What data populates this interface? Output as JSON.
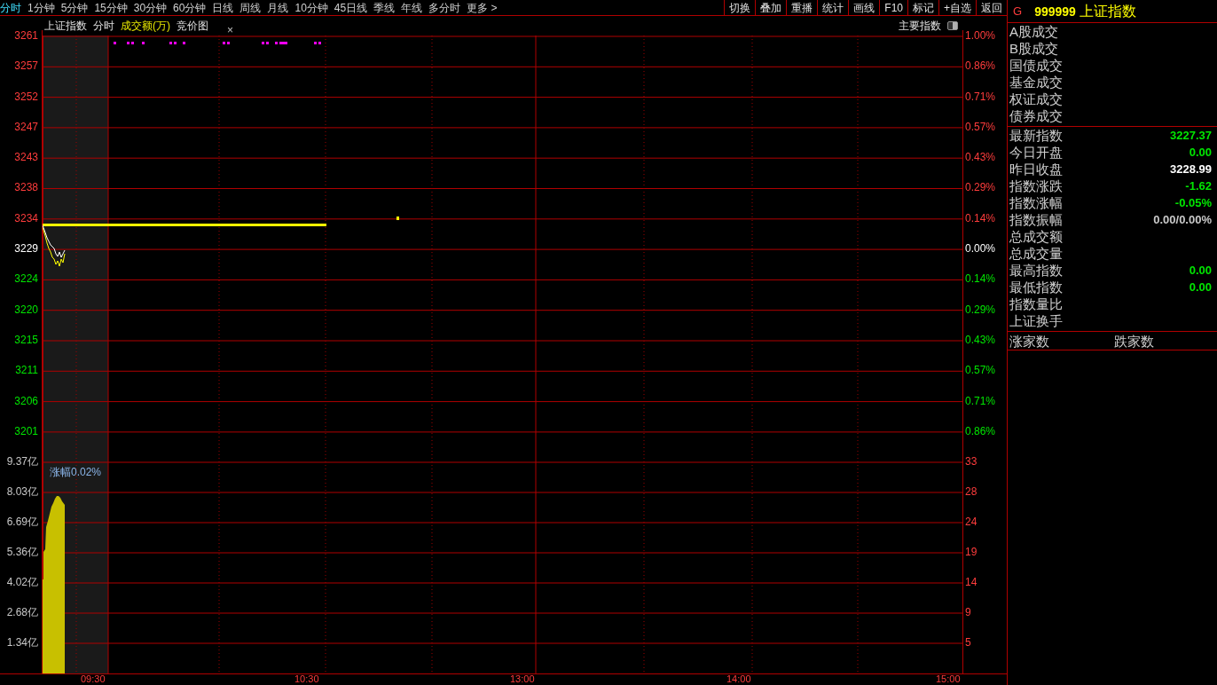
{
  "periods": [
    {
      "label": "分时",
      "selected": true
    },
    {
      "label": "1分钟",
      "selected": false
    },
    {
      "label": "5分钟",
      "selected": false
    },
    {
      "label": "15分钟",
      "selected": false
    },
    {
      "label": "30分钟",
      "selected": false
    },
    {
      "label": "60分钟",
      "selected": false
    },
    {
      "label": "日线",
      "selected": false
    },
    {
      "label": "周线",
      "selected": false
    },
    {
      "label": "月线",
      "selected": false
    },
    {
      "label": "10分钟",
      "selected": false
    },
    {
      "label": "45日线",
      "selected": false
    },
    {
      "label": "季线",
      "selected": false
    },
    {
      "label": "年线",
      "selected": false
    },
    {
      "label": "多分时",
      "selected": false
    },
    {
      "label": "更多 >",
      "selected": false
    }
  ],
  "toolbar_buttons": [
    "切换",
    "叠加",
    "重播",
    "统计",
    "画线",
    "F10",
    "标记",
    "+自选",
    "返回"
  ],
  "chart_header": {
    "title": "上证指数",
    "tabs": [
      {
        "label": "分时",
        "kind": "plain"
      },
      {
        "label": "成交额(万)",
        "kind": "highlight"
      },
      {
        "label": "竞价图",
        "kind": "plain"
      }
    ],
    "close_mark": "×",
    "index_label": "主要指数"
  },
  "price_axis": [
    {
      "label": "3261",
      "kind": "up"
    },
    {
      "label": "3257",
      "kind": "up"
    },
    {
      "label": "3252",
      "kind": "up"
    },
    {
      "label": "3247",
      "kind": "up"
    },
    {
      "label": "3243",
      "kind": "up"
    },
    {
      "label": "3238",
      "kind": "up"
    },
    {
      "label": "3234",
      "kind": "up"
    },
    {
      "label": "3229",
      "kind": "flat"
    },
    {
      "label": "3224",
      "kind": "down"
    },
    {
      "label": "3220",
      "kind": "down"
    },
    {
      "label": "3215",
      "kind": "down"
    },
    {
      "label": "3211",
      "kind": "down"
    },
    {
      "label": "3206",
      "kind": "down"
    },
    {
      "label": "3201",
      "kind": "down"
    }
  ],
  "percent_axis": [
    {
      "label": "1.00%",
      "kind": "up"
    },
    {
      "label": "0.86%",
      "kind": "up"
    },
    {
      "label": "0.71%",
      "kind": "up"
    },
    {
      "label": "0.57%",
      "kind": "up"
    },
    {
      "label": "0.43%",
      "kind": "up"
    },
    {
      "label": "0.29%",
      "kind": "up"
    },
    {
      "label": "0.14%",
      "kind": "up"
    },
    {
      "label": "0.00%",
      "kind": "flat"
    },
    {
      "label": "0.14%",
      "kind": "down"
    },
    {
      "label": "0.29%",
      "kind": "down"
    },
    {
      "label": "0.43%",
      "kind": "down"
    },
    {
      "label": "0.57%",
      "kind": "down"
    },
    {
      "label": "0.71%",
      "kind": "down"
    },
    {
      "label": "0.86%",
      "kind": "down"
    }
  ],
  "volume_axis": [
    "9.37亿",
    "8.03亿",
    "6.69亿",
    "5.36亿",
    "4.02亿",
    "2.68亿",
    "1.34亿"
  ],
  "volume_right_axis": [
    "33",
    "28",
    "24",
    "19",
    "14",
    "9",
    "5"
  ],
  "volume_note": "涨幅0.02%",
  "time_axis": [
    "09:30",
    "10:30",
    "13:00",
    "14:00",
    "15:00"
  ],
  "side_panel": {
    "market": "G",
    "code": "999999",
    "name": "上证指数",
    "turnover_rows": [
      "A股成交",
      "B股成交",
      "国债成交",
      "基金成交",
      "权证成交",
      "债券成交"
    ],
    "stats": [
      {
        "label": "最新指数",
        "value": "3227.37",
        "kind": "down"
      },
      {
        "label": "今日开盘",
        "value": "0.00",
        "kind": "down"
      },
      {
        "label": "昨日收盘",
        "value": "3228.99",
        "kind": "flat"
      },
      {
        "label": "指数涨跌",
        "value": "-1.62",
        "kind": "down"
      },
      {
        "label": "指数涨幅",
        "value": "-0.05%",
        "kind": "down"
      },
      {
        "label": "指数振幅",
        "value": "0.00/0.00%",
        "kind": "neutral"
      },
      {
        "label": "总成交额"
      },
      {
        "label": "总成交量"
      },
      {
        "label": "最高指数",
        "value": "0.00",
        "kind": "down"
      },
      {
        "label": "最低指数",
        "value": "0.00",
        "kind": "down"
      },
      {
        "label": "指数量比"
      },
      {
        "label": "上证换手"
      }
    ],
    "breadth": [
      "涨家数",
      "跌家数"
    ]
  }
}
